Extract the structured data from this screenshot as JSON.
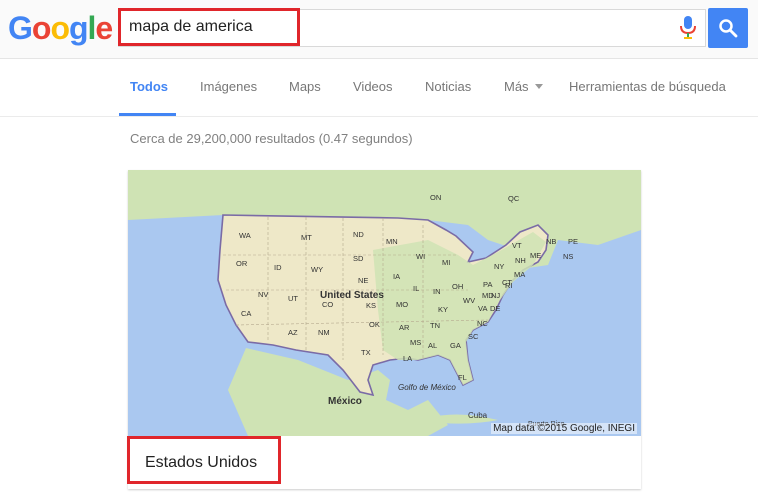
{
  "logo": {
    "letters": [
      "G",
      "o",
      "o",
      "g",
      "l",
      "e"
    ],
    "colors": [
      "#4285f4",
      "#ea4335",
      "#fbbc05",
      "#4285f4",
      "#34a853",
      "#ea4335"
    ]
  },
  "search": {
    "query": "mapa de america"
  },
  "tabs": [
    {
      "label": "Todos",
      "active": true
    },
    {
      "label": "Imágenes"
    },
    {
      "label": "Maps"
    },
    {
      "label": "Videos"
    },
    {
      "label": "Noticias"
    },
    {
      "label": "Más"
    },
    {
      "label": "Herramientas de búsqueda"
    }
  ],
  "results_info": "Cerca de 29,200,000 resultados (0.47 segundos)",
  "map": {
    "country_label": "United States",
    "state_labels": [
      "WA",
      "MT",
      "ND",
      "MN",
      "OR",
      "ID",
      "SD",
      "WI",
      "MI",
      "WY",
      "NE",
      "IA",
      "NV",
      "UT",
      "CO",
      "KS",
      "MO",
      "IL",
      "IN",
      "OH",
      "CA",
      "AZ",
      "NM",
      "OK",
      "AR",
      "TN",
      "KY",
      "WV",
      "VA",
      "NC",
      "SC",
      "GA",
      "AL",
      "MS",
      "LA",
      "TX",
      "FL",
      "PA",
      "NY",
      "VT",
      "NH",
      "ME",
      "MA",
      "CT",
      "NJ",
      "DE",
      "MD",
      "RI",
      "PE",
      "NS",
      "NB",
      "QC",
      "ON"
    ],
    "place_labels": [
      "México",
      "Golfo de México",
      "Cuba",
      "Puerto Rico"
    ],
    "credit": "Map data ©2015 Google, INEGI"
  },
  "card": {
    "title": "Estados Unidos"
  },
  "colors": {
    "accent": "#4285f4",
    "highlight": "#e0262b",
    "water": "#aac8f0",
    "land": "#cfe3b4",
    "us_land": "#eee8c8",
    "border": "#7a6ba6"
  }
}
